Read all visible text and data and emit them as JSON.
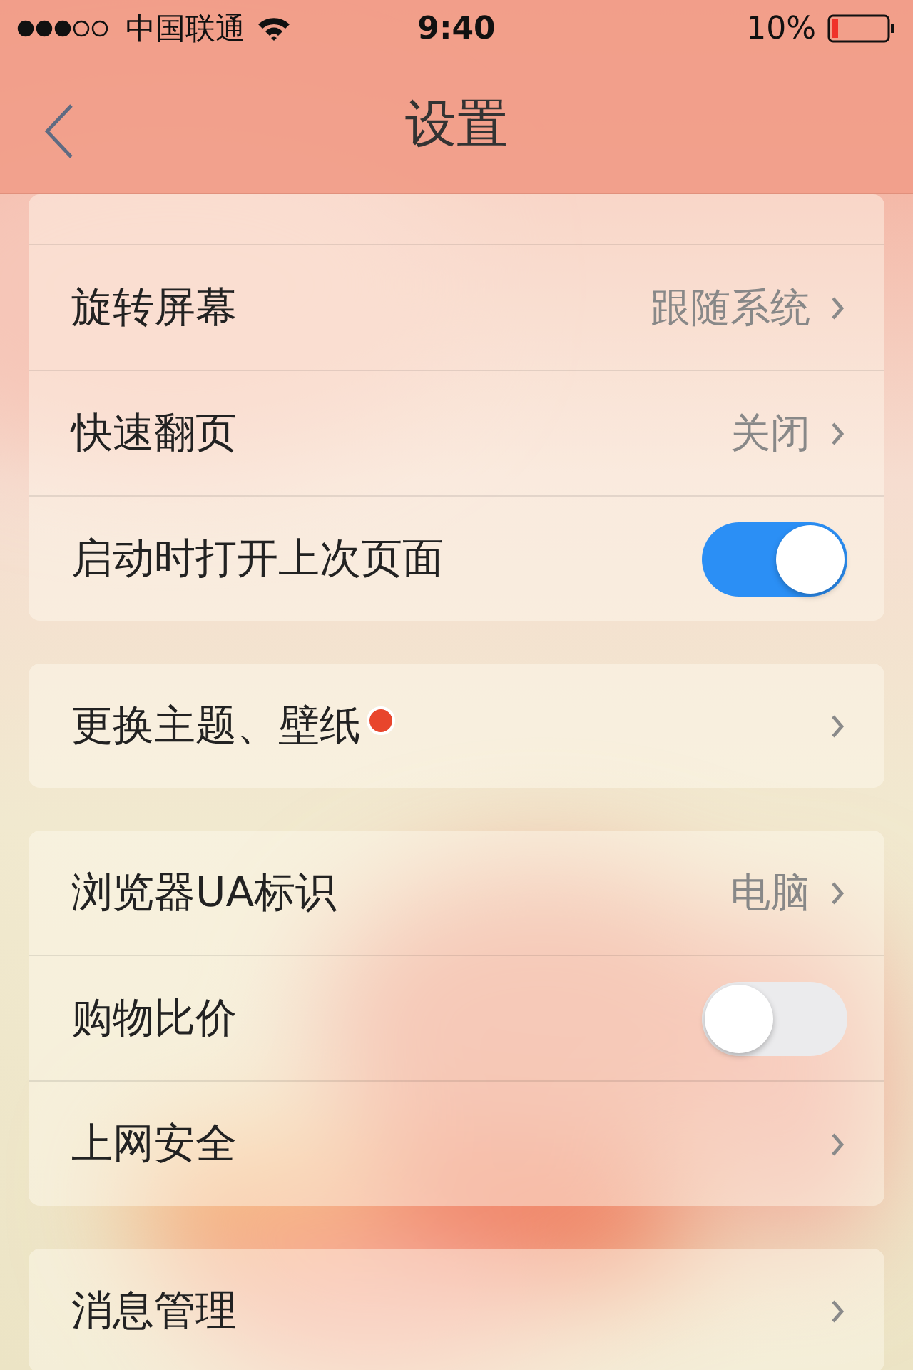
{
  "status_bar": {
    "carrier": "中国联通",
    "time": "9:40",
    "battery": "10%"
  },
  "nav": {
    "title": "设置"
  },
  "groups": [
    {
      "rows": [
        {
          "kind": "link",
          "label": "旋转屏幕",
          "value": "跟随系统",
          "new": false
        },
        {
          "kind": "link",
          "label": "快速翻页",
          "value": "关闭",
          "new": false
        },
        {
          "kind": "toggle",
          "label": "启动时打开上次页面",
          "on": true
        }
      ]
    },
    {
      "rows": [
        {
          "kind": "link",
          "label": "更换主题、壁纸",
          "new": true
        }
      ]
    },
    {
      "rows": [
        {
          "kind": "link",
          "label": "浏览器UA标识",
          "value": "电脑",
          "new": false
        },
        {
          "kind": "toggle",
          "label": "购物比价",
          "on": false
        },
        {
          "kind": "link",
          "label": "上网安全",
          "new": false
        }
      ]
    },
    {
      "rows": [
        {
          "kind": "link",
          "label": "消息管理",
          "new": false
        }
      ]
    }
  ]
}
